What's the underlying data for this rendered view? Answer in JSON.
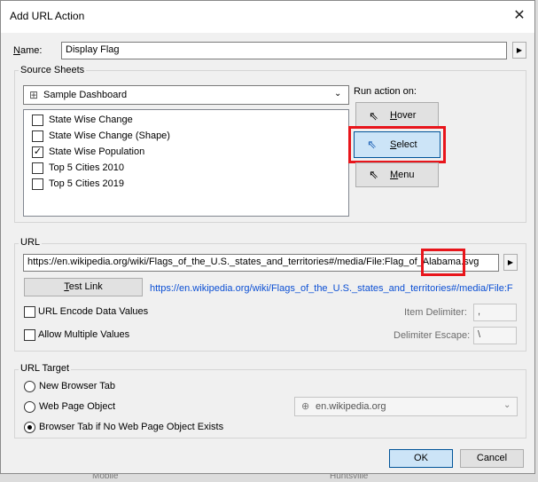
{
  "window": {
    "title": "Add URL Action"
  },
  "name": {
    "label": "Name:",
    "value": "Display Flag"
  },
  "source_sheets": {
    "label": "Source Sheets",
    "dashboard": "Sample Dashboard",
    "sheets": [
      {
        "label": "State Wise Change",
        "checked": false
      },
      {
        "label": "State Wise Change (Shape)",
        "checked": false
      },
      {
        "label": "State Wise Population",
        "checked": true
      },
      {
        "label": "Top 5 Cities 2010",
        "checked": false
      },
      {
        "label": "Top 5 Cities 2019",
        "checked": false
      }
    ],
    "run_on_label": "Run action on:",
    "run_options": {
      "hover": "Hover",
      "select": "Select",
      "menu": "Menu"
    }
  },
  "url": {
    "label": "URL",
    "value": "https://en.wikipedia.org/wiki/Flags_of_the_U.S._states_and_territories#/media/File:Flag_of_Alabama.svg",
    "test_link": "Test Link",
    "preview_link": "https://en.wikipedia.org/wiki/Flags_of_the_U.S._states_and_territories#/media/File:F",
    "encode_label": "URL Encode Data Values",
    "multi_label": "Allow Multiple Values",
    "item_delim_label": "Item Delimiter:",
    "item_delim_value": ",",
    "delim_escape_label": "Delimiter Escape:",
    "delim_escape_value": "\\"
  },
  "url_target": {
    "label": "URL Target",
    "options": [
      "New Browser Tab",
      "Web Page Object",
      "Browser Tab if No Web Page Object Exists"
    ],
    "selected_index": 2,
    "web_object": "en.wikipedia.org"
  },
  "footer": {
    "ok": "OK",
    "cancel": "Cancel"
  },
  "background": {
    "left_text": "Mobile",
    "right_text": "Huntsville"
  }
}
